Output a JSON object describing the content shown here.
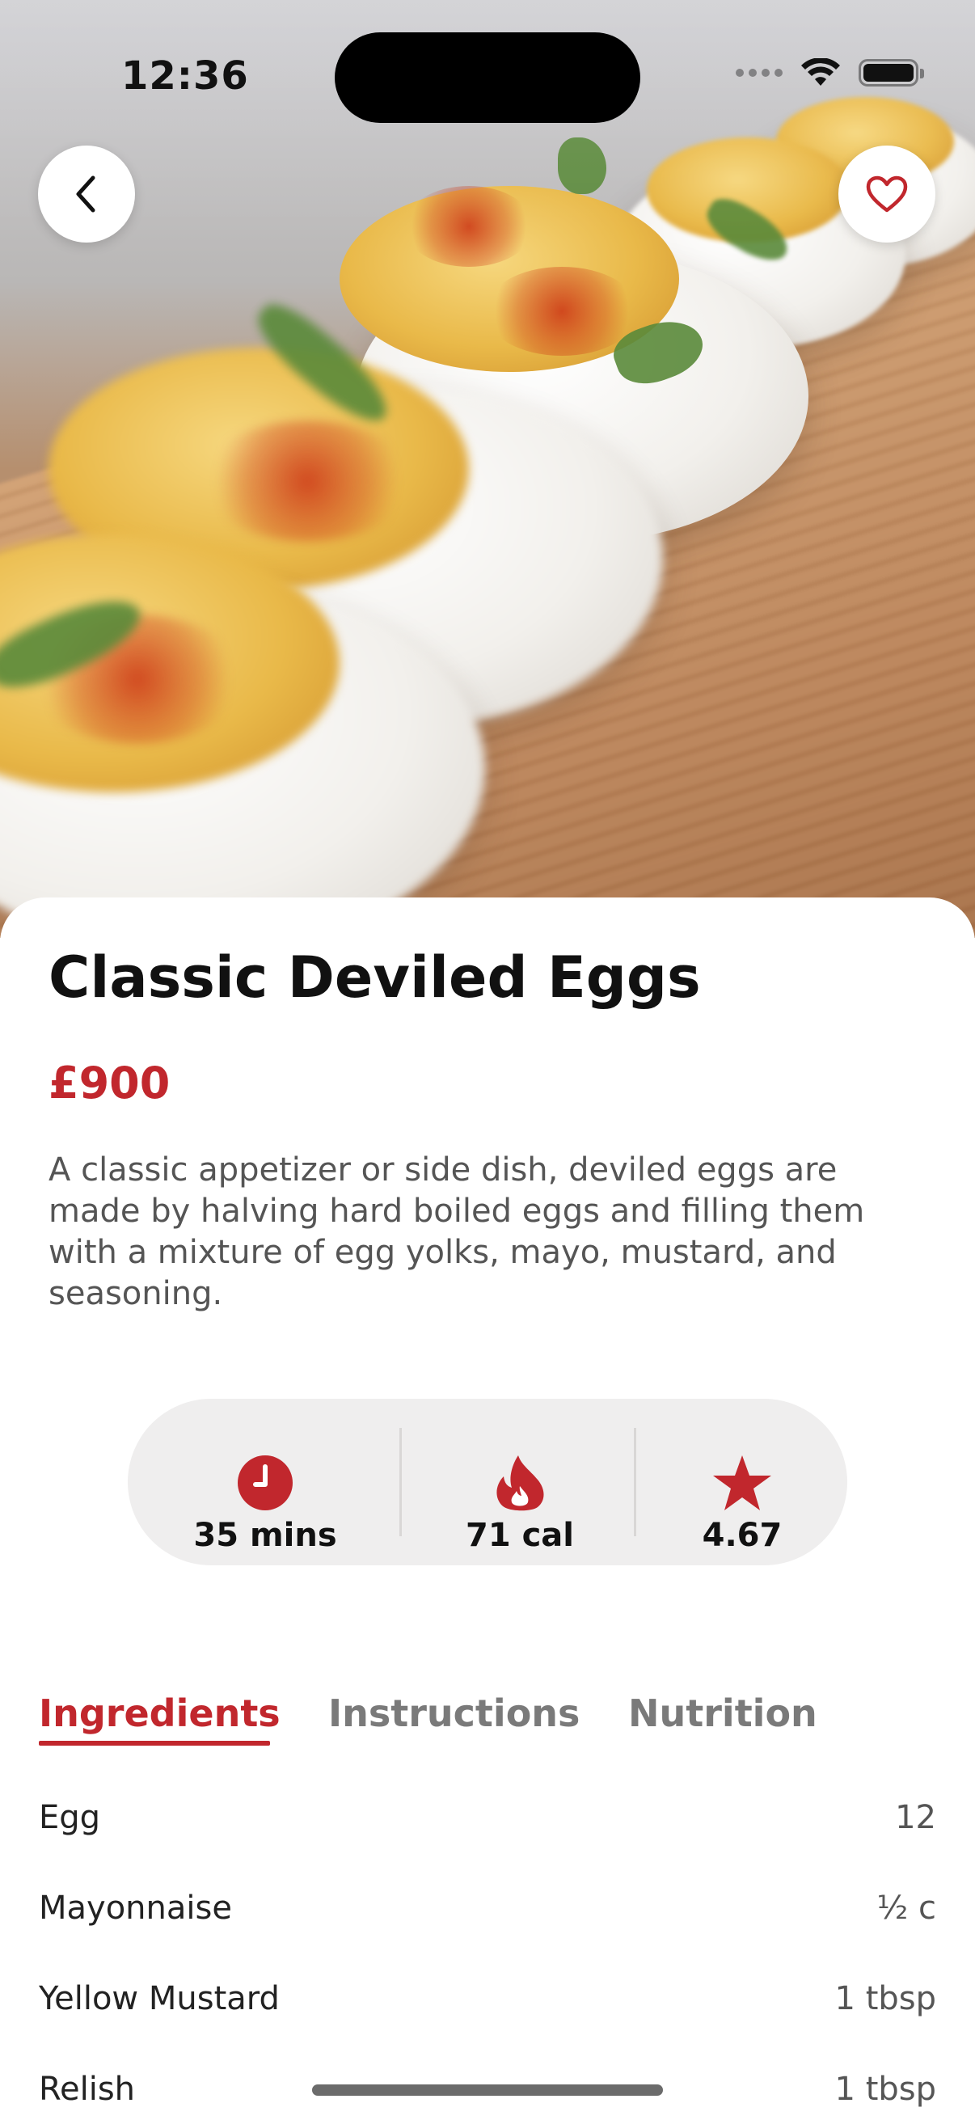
{
  "status_bar": {
    "time": "12:36"
  },
  "header": {
    "back_icon": "chevron-left-icon",
    "favorite_icon": "heart-outline-icon"
  },
  "recipe": {
    "title": "Classic Deviled Eggs",
    "price": "£900",
    "description": "A classic appetizer or side dish, deviled eggs are made by halving hard boiled eggs and filling them with a mixture of egg yolks, mayo, mustard, and seasoning."
  },
  "stats": {
    "time": {
      "icon": "clock-icon",
      "value": "35 mins"
    },
    "calories": {
      "icon": "flame-icon",
      "value": "71 cal"
    },
    "rating": {
      "icon": "star-icon",
      "value": "4.67"
    }
  },
  "tabs": [
    {
      "label": "Ingredients",
      "active": true
    },
    {
      "label": "Instructions",
      "active": false
    },
    {
      "label": "Nutrition",
      "active": false
    }
  ],
  "ingredients": [
    {
      "name": "Egg",
      "quantity": "12"
    },
    {
      "name": "Mayonnaise",
      "quantity": "½ c"
    },
    {
      "name": "Yellow Mustard",
      "quantity": "1 tbsp"
    },
    {
      "name": "Relish",
      "quantity": "1 tbsp"
    }
  ],
  "colors": {
    "accent": "#c1272d",
    "text_primary": "#111111",
    "text_secondary": "#555555",
    "tab_inactive": "#7a7a7a",
    "stats_background": "#efeeee"
  }
}
